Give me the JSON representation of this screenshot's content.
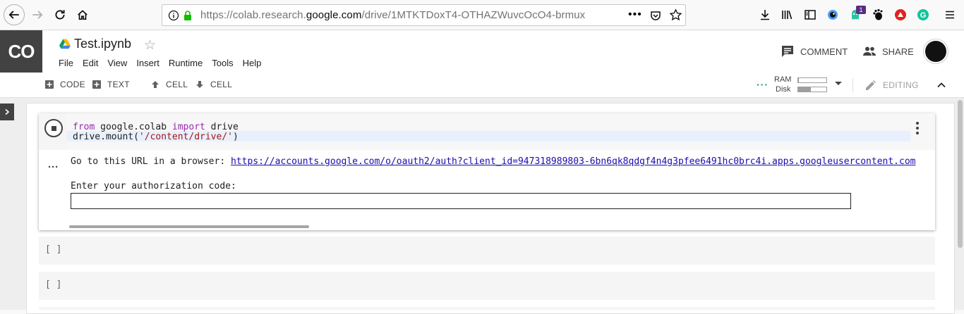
{
  "browser": {
    "url_prefix": "https://colab.research.",
    "url_domain": "google.com",
    "url_path": "/drive/1MTKTDoxT4-OTHAZWuvcOcO4-brmux",
    "notification_badge": "1"
  },
  "header": {
    "logo": "CO",
    "notebook_title": "Test.ipynb",
    "menu": [
      "File",
      "Edit",
      "View",
      "Insert",
      "Runtime",
      "Tools",
      "Help"
    ],
    "comment_label": "COMMENT",
    "share_label": "SHARE"
  },
  "toolbar": {
    "code_label": "CODE",
    "text_label": "TEXT",
    "cell_up_label": "CELL",
    "cell_down_label": "CELL",
    "ram_label": "RAM",
    "disk_label": "Disk",
    "ram_fraction": 0.03,
    "disk_fraction": 0.45,
    "editing_label": "EDITING"
  },
  "cell": {
    "code_line1_kw1": "from",
    "code_line1_mod": " google.colab ",
    "code_line1_kw2": "import",
    "code_line1_name": " drive",
    "code_line2_pre": "drive.mount(",
    "code_line2_str": "'/content/drive/'",
    "code_line2_post": ")",
    "output_url_prompt": "Go to this URL in a browser: ",
    "output_url": "https://accounts.google.com/o/oauth2/auth?client_id=947318989803-6bn6qk8qdgf4n4g3pfee6491hc0brc4i.apps.googleusercontent.com",
    "auth_prompt": "Enter your authorization code:",
    "auth_value": ""
  },
  "empty_cells": [
    "[ ]",
    "[ ]"
  ],
  "colors": {
    "accent_green": "#0f9d58",
    "logo_bg": "#424242",
    "link": "#1a0dab"
  }
}
